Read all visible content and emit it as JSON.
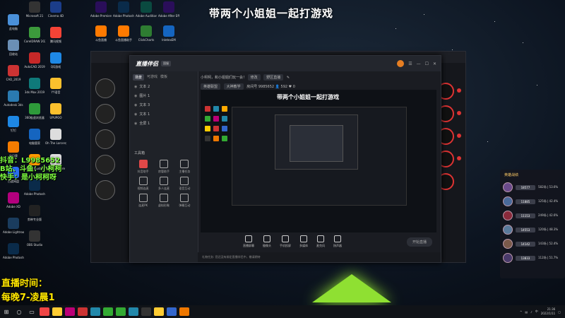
{
  "overlay": {
    "title": "带两个小姐姐一起打游戏",
    "douyin": "抖音：L9985652",
    "bilibili": "B站、斗鱼：小柯柯",
    "kuaishou": "快手：是小柯柯呀",
    "live_time_label": "直播时间：",
    "live_time_value": "每晚7-凌晨1"
  },
  "desktop_icons_col1": [
    {
      "label": "此电脑",
      "color": "#4a90d9",
      "icon": "computer-icon"
    },
    {
      "label": "回收站",
      "color": "#6b8fb5",
      "icon": "recycle-bin-icon"
    },
    {
      "label": "CAD_2019",
      "color": "#c33",
      "icon": "autocad-icon"
    },
    {
      "label": "Autodesk 3ds",
      "color": "#2a7ab0",
      "icon": "autodesk-icon"
    },
    {
      "label": "钉钉",
      "color": "#1e88e5",
      "icon": "dingtalk-icon"
    },
    {
      "label": "向日葵",
      "color": "#f57c00",
      "icon": "sunflower-icon"
    },
    {
      "label": "百度网盘",
      "color": "#2b6ef2",
      "icon": "baidu-pan-icon"
    },
    {
      "label": "Adobe XD",
      "color": "#b3007d",
      "icon": "adobe-xd-icon"
    },
    {
      "label": "Adobe Lightroom",
      "color": "#1a3c5e",
      "icon": "lightroom-icon"
    },
    {
      "label": "Adobe Photoshop",
      "color": "#0a2b4a",
      "icon": "photoshop-icon"
    }
  ],
  "desktop_icons_col2": [
    {
      "label": "Microsoft 21",
      "color": "#333",
      "icon": "microsoft-icon"
    },
    {
      "label": "CorelDRAW 2020",
      "color": "#3c9a3c",
      "icon": "coreldraw-icon"
    },
    {
      "label": "AutoCAD 2019",
      "color": "#c62828",
      "icon": "autocad-icon"
    },
    {
      "label": "3ds Max 2019",
      "color": "#0f7a7a",
      "icon": "3dsmax-icon"
    },
    {
      "label": "360极速浏览器",
      "color": "#2e9a3a",
      "icon": "browser-icon"
    },
    {
      "label": "电脑管家",
      "color": "#1565c0",
      "icon": "pc-manager-icon"
    },
    {
      "label": "Adobe Illustrator",
      "color": "#ff9a00",
      "icon": "illustrator-icon"
    },
    {
      "label": "Adobe Photoshop",
      "color": "#0a2b4a",
      "icon": "photoshop-icon"
    },
    {
      "label": "剪映专业版",
      "color": "#222",
      "icon": "capcut-icon"
    },
    {
      "label": "OBS Studio",
      "color": "#333",
      "icon": "obs-icon"
    }
  ],
  "desktop_icons_col3": [
    {
      "label": "Cinema 4D",
      "color": "#1b3d8a",
      "icon": "cinema4d-icon"
    },
    {
      "label": "腾讯视频",
      "color": "#f44336",
      "icon": "tencent-video-icon"
    },
    {
      "label": "QQ游戏",
      "color": "#1e88e5",
      "icon": "qq-game-icon"
    },
    {
      "label": "YY语音",
      "color": "#fbc02d",
      "icon": "yy-icon"
    },
    {
      "label": "UPUPOO",
      "color": "#fbc02d",
      "icon": "upupoo-icon"
    },
    {
      "label": "Oh The Larceny",
      "color": "#ddd",
      "icon": "document-icon"
    },
    {
      "label": "Nora En Pure",
      "color": "#ddd",
      "icon": "document-icon"
    }
  ],
  "desktop_icons_top": [
    {
      "label": "Adobe Premiere",
      "color": "#2a0e5a",
      "icon": "premiere-icon"
    },
    {
      "label": "Adobe Photoshop",
      "color": "#0a2b4a",
      "icon": "photoshop-icon"
    },
    {
      "label": "Adobe Audition",
      "color": "#0a4a40",
      "icon": "audition-icon"
    },
    {
      "label": "Adobe After Effects CC",
      "color": "#2a0e5a",
      "icon": "after-effects-icon"
    }
  ],
  "desktop_icons_row2": [
    {
      "label": "斗鱼直播",
      "color": "#ff7a00",
      "icon": "douyu-icon"
    },
    {
      "label": "斗鱼直播助手",
      "color": "#ff7a00",
      "icon": "douyu-icon"
    },
    {
      "label": "ClickCharts",
      "color": "#2e7d32",
      "icon": "clickcharts-icon"
    },
    {
      "label": "InletexEM",
      "color": "#1565c0",
      "icon": "inletex-icon"
    }
  ],
  "app": {
    "logo": "直播伴侣",
    "tag": "国服",
    "tabs": [
      "场景",
      "可游戏",
      "模板"
    ],
    "scenes": [
      "文本 2",
      "图片 1",
      "文本 3",
      "文本 1",
      "全屏 1"
    ],
    "tools_title": "工具箱",
    "tools": [
      {
        "label": "抖音助手",
        "red": true
      },
      {
        "label": "房管助手",
        "red": false
      },
      {
        "label": "主播任务",
        "red": false
      },
      {
        "label": "视频连麦",
        "red": false
      },
      {
        "label": "多人连麦",
        "red": false
      },
      {
        "label": "语音互动",
        "red": false
      },
      {
        "label": "连麦PK",
        "red": false
      },
      {
        "label": "虚拟形象",
        "red": false
      },
      {
        "label": "弹幕互动",
        "red": false
      }
    ],
    "topbar": {
      "title": "小柯柯，和小姐姐们玩一会！",
      "edit": "修改",
      "section": "野区直播",
      "tag1": "英雄联盟",
      "tag2": "大神教学",
      "room_label": "房间号",
      "room_id": "9985652",
      "viewers": "592",
      "likes": "0"
    },
    "preview_title": "带两个小姐姐一起打游戏",
    "controls": [
      "直播屏幕",
      "摄像头",
      "手机投屏",
      "多媒体",
      "麦克风",
      "扬声器"
    ],
    "start_button": "开始直播",
    "status": "礼物任务: 您还没有绑定直播伴侣中，敬请期待"
  },
  "leaderboard": {
    "title": "英雄战绩",
    "rows": [
      {
        "score": "18577",
        "stat": "582场 | 53.6%"
      },
      {
        "score": "11885",
        "stat": "125场 | 42.4%"
      },
      {
        "score": "11153",
        "stat": "249场 | 42.6%"
      },
      {
        "score": "14553",
        "stat": "120场 | 48.3%"
      },
      {
        "score": "14142",
        "stat": "143场 | 52.4%"
      },
      {
        "score": "13833",
        "stat": "112场 | 51.7%"
      }
    ]
  },
  "taskbar": {
    "time": "21:36",
    "date": "2022/1/11"
  }
}
